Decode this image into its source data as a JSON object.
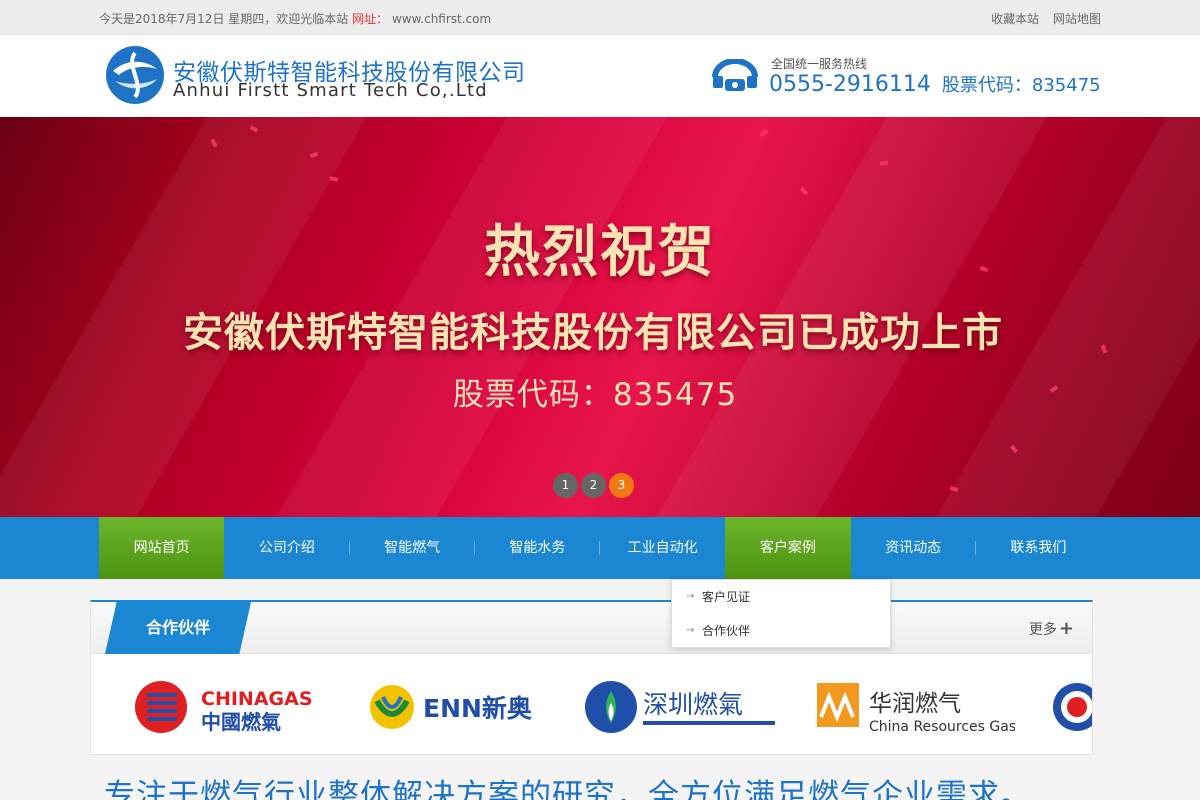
{
  "topbar": {
    "date_text": "今天是2018年7月12日 星期四，欢迎光临本站",
    "url_label": "网址：",
    "url_value": "www.chfirst.com",
    "bookmark": "收藏本站",
    "sitemap": "网站地图"
  },
  "header": {
    "company_cn": "安徽伏斯特智能科技股份有限公司",
    "company_en": "Anhui Firstt Smart Tech Co,.Ltd",
    "hotline_label": "全国统一服务热线",
    "hotline_phone": "0555-2916114",
    "stock_code": "股票代码：835475"
  },
  "banner": {
    "line1": "热烈祝贺",
    "line2": "安徽伏斯特智能科技股份有限公司已成功上市",
    "line3": "股票代码：835475",
    "dots": [
      "1",
      "2",
      "3"
    ],
    "active_dot": 3
  },
  "nav": {
    "items": [
      {
        "label": "网站首页"
      },
      {
        "label": "公司介绍"
      },
      {
        "label": "智能燃气"
      },
      {
        "label": "智能水务"
      },
      {
        "label": "工业自动化"
      },
      {
        "label": "客户案例"
      },
      {
        "label": "资讯动态"
      },
      {
        "label": "联系我们"
      }
    ],
    "dropdown": [
      "客户见证",
      "合作伙伴"
    ]
  },
  "partners": {
    "section_title": "合作伙伴",
    "more_label": "更多",
    "logos": [
      {
        "name": "chinagas",
        "text_top": "CHINAGAS",
        "text_bottom": "中國燃氣"
      },
      {
        "name": "enn",
        "text": "ENN新奥"
      },
      {
        "name": "shenzhen-gas",
        "text": "深圳燃氣"
      },
      {
        "name": "cr-gas",
        "text_top": "华润燃气",
        "text_bottom": "China Resources Gas"
      }
    ]
  },
  "slogan": "专注于燃气行业整体解决方案的研究，全方位满足燃气企业需求。",
  "colors": {
    "brand_blue": "#1b86d1",
    "nav_green": "#5ba31d",
    "banner_red": "#d7003a",
    "accent_orange": "#f07a12"
  }
}
